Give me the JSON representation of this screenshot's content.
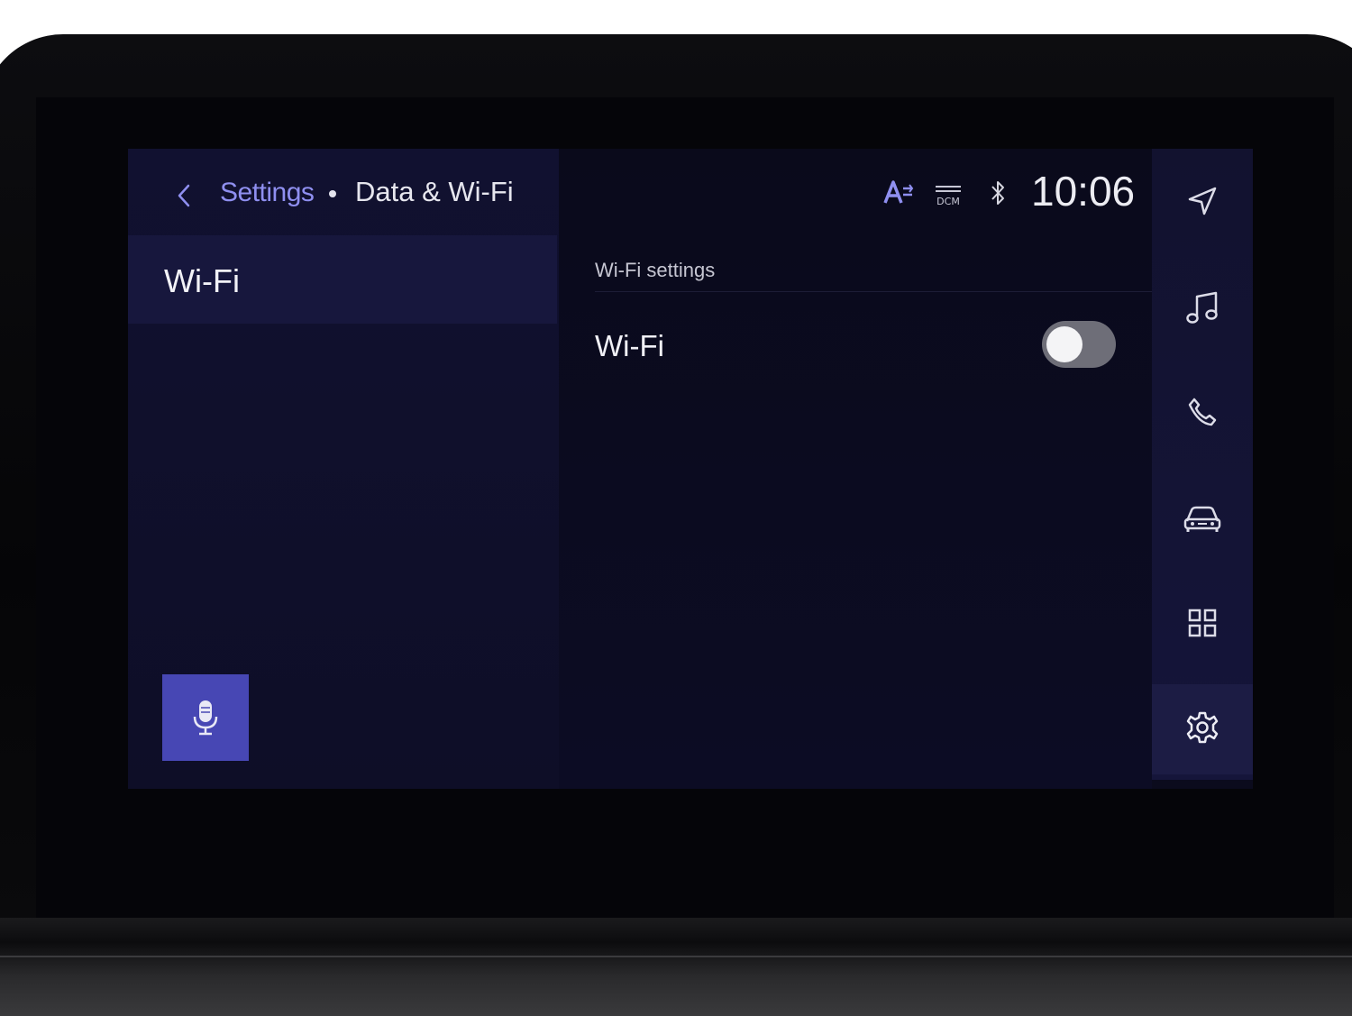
{
  "header": {
    "breadcrumb_parent": "Settings",
    "breadcrumb_current": "Data & Wi-Fi",
    "time": "10:06",
    "status_icons": [
      "text-a-icon",
      "dcm-icon",
      "bluetooth-icon"
    ],
    "dcm_label": "DCM"
  },
  "sidebar": {
    "items": [
      {
        "label": "Wi-Fi",
        "selected": true
      }
    ]
  },
  "main": {
    "section_header": "Wi-Fi settings",
    "rows": [
      {
        "label": "Wi-Fi",
        "toggle_on": false
      }
    ]
  },
  "rail": {
    "items": [
      {
        "icon": "navigation-icon"
      },
      {
        "icon": "music-note-icon"
      },
      {
        "icon": "phone-icon"
      },
      {
        "icon": "car-icon"
      },
      {
        "icon": "apps-grid-icon"
      },
      {
        "icon": "gear-icon",
        "active": true
      }
    ]
  },
  "colors": {
    "accent": "#8f8ff0",
    "mic_button": "#4747b4",
    "toggle_off": "#6e6e78",
    "screen_bg": "#0b0b1d",
    "selected_item": "#17173d"
  }
}
